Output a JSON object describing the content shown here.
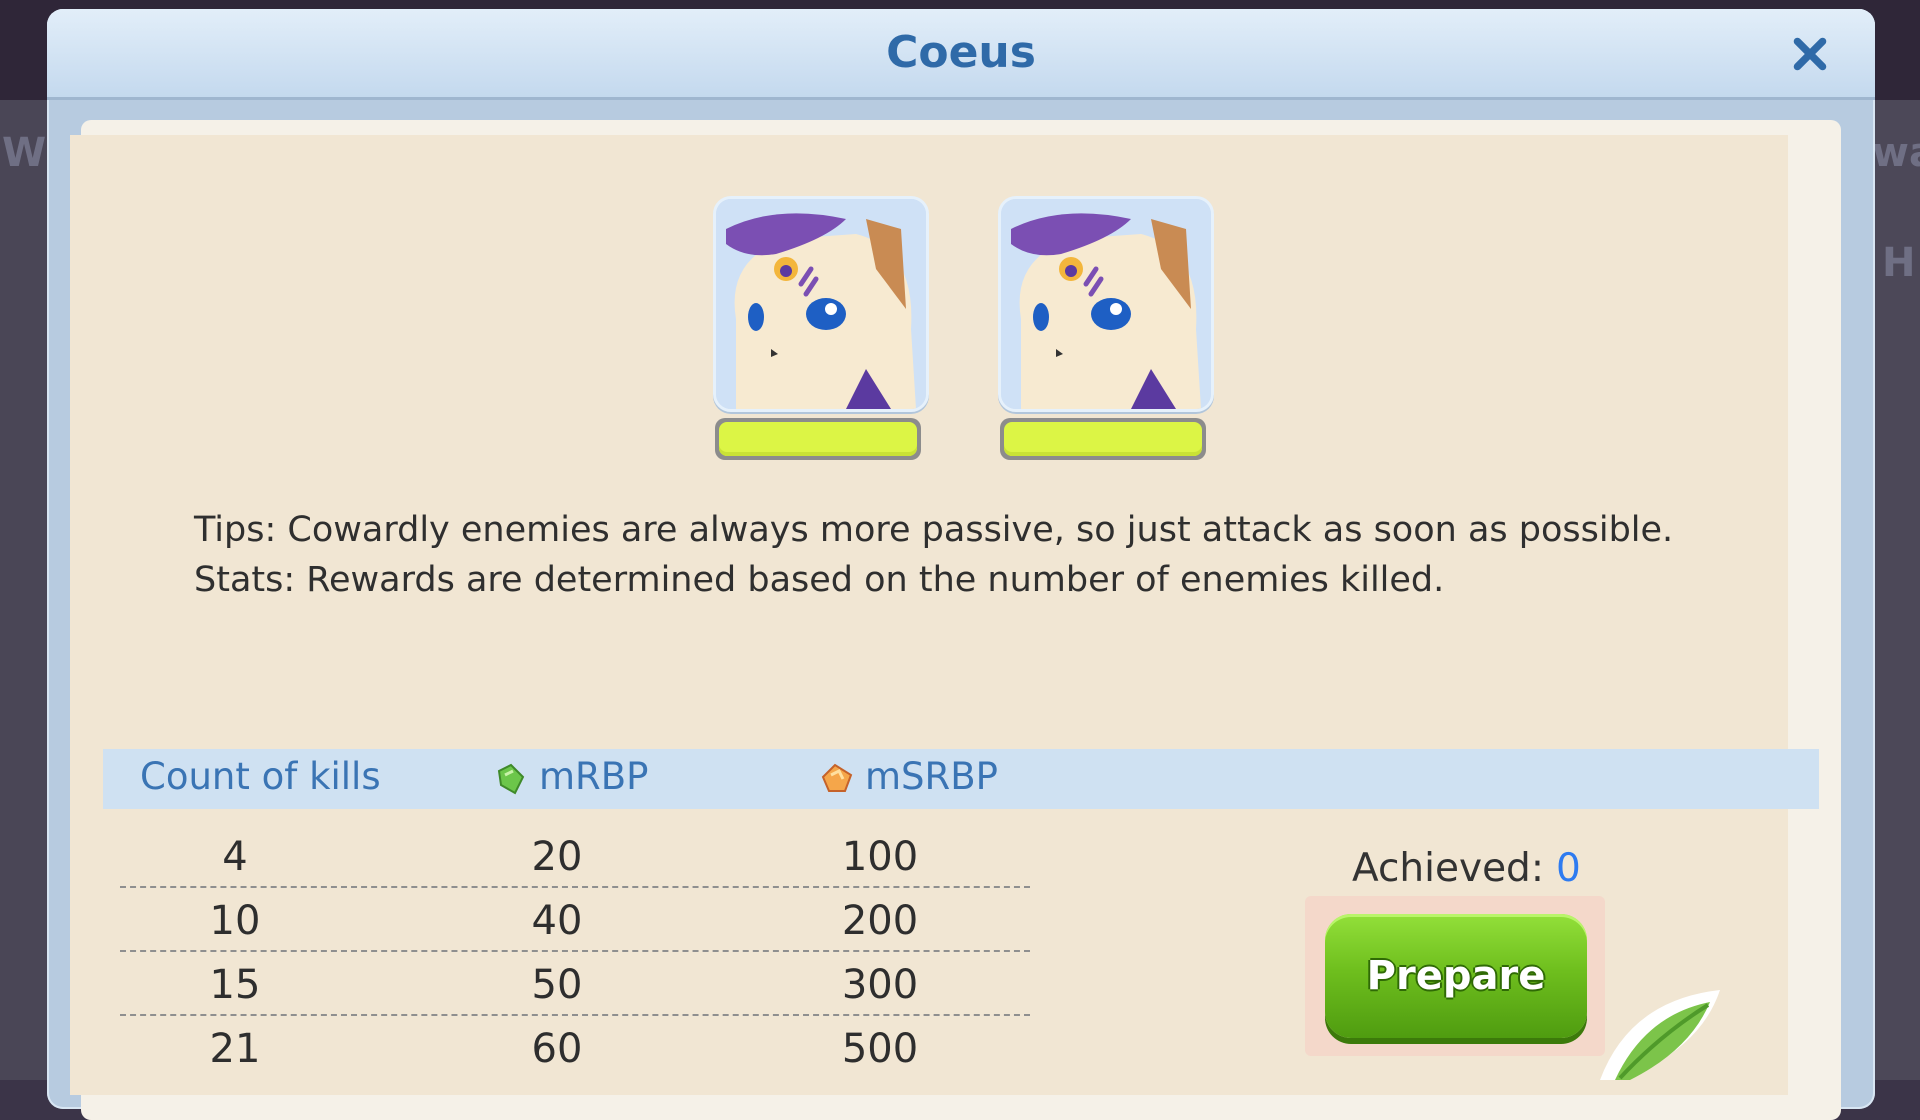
{
  "modal": {
    "title": "Coeus"
  },
  "background_fragments": {
    "left": "W",
    "right_top": "wa",
    "right_mid": "H"
  },
  "enemies": [
    {
      "name": "enemy-portrait",
      "hp_fraction": 1.0
    },
    {
      "name": "enemy-portrait",
      "hp_fraction": 1.0
    }
  ],
  "tips": {
    "line1": "Tips: Cowardly enemies are always more passive, so just attack as soon as possible.",
    "line2": "Stats: Rewards are determined based on the number of enemies killed."
  },
  "rewards_table": {
    "headers": {
      "kills": "Count of kills",
      "mrbp": "mRBP",
      "msrbp": "mSRBP"
    },
    "rows": [
      {
        "kills": "4",
        "mrbp": "20",
        "msrbp": "100"
      },
      {
        "kills": "10",
        "mrbp": "40",
        "msrbp": "200"
      },
      {
        "kills": "15",
        "mrbp": "50",
        "msrbp": "300"
      },
      {
        "kills": "21",
        "mrbp": "60",
        "msrbp": "500"
      }
    ]
  },
  "achieved": {
    "label": "Achieved:",
    "value": "0"
  },
  "prepare_button": {
    "label": "Prepare"
  },
  "icons": {
    "close": "close-icon",
    "mrbp": "green-gem-icon",
    "msrbp": "orange-gem-icon"
  },
  "colors": {
    "title": "#2f6aa8",
    "accent_blue": "#2e7bf0",
    "button_green": "#6fbf1e",
    "hp_bar": "#dcf545"
  }
}
